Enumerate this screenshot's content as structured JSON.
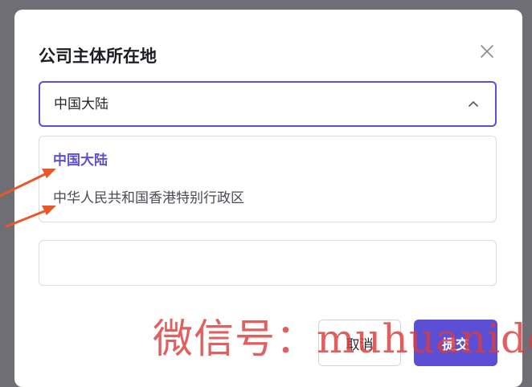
{
  "dialog": {
    "title": "公司主体所在地",
    "close_icon": "close-icon"
  },
  "select": {
    "value": "中国大陆",
    "chevron_icon": "chevron-up-icon",
    "options": [
      {
        "label": "中国大陆",
        "selected": true
      },
      {
        "label": "中华人民共和国香港特别行政区",
        "selected": false
      }
    ]
  },
  "text_input": {
    "value": "",
    "placeholder": ""
  },
  "footer": {
    "cancel_label": "取消",
    "submit_label": "提交"
  },
  "annotations": {
    "arrow_color": "#e8582b",
    "watermark_text": "微信号：muhuanidc"
  },
  "colors": {
    "accent": "#5b4fd6",
    "overlay": "#6e6e74"
  }
}
